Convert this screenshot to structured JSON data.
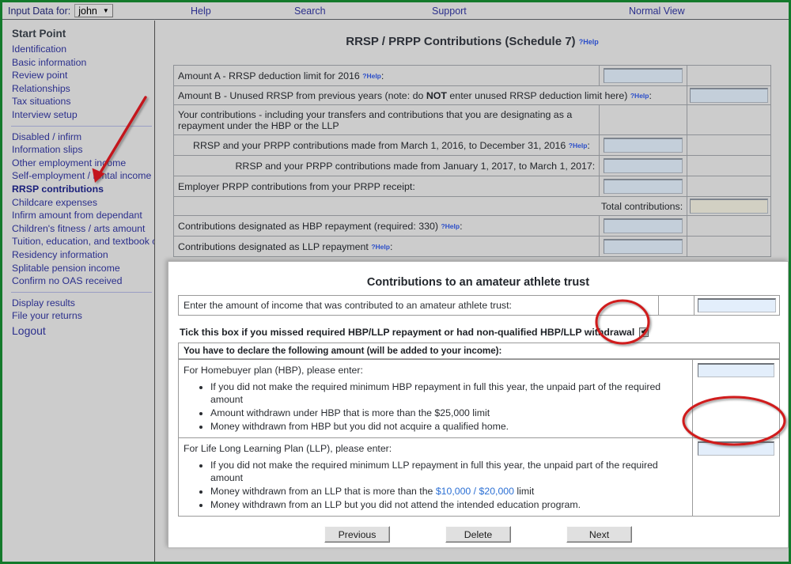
{
  "topbar": {
    "input_data_label": "Input Data for:",
    "user": "john",
    "caret": "▼",
    "help": "Help",
    "search": "Search",
    "support": "Support",
    "normal_view": "Normal View"
  },
  "sidebar": {
    "title": "Start Point",
    "group1": [
      {
        "label": "Identification"
      },
      {
        "label": "Basic information"
      },
      {
        "label": "Review point"
      },
      {
        "label": "Relationships"
      },
      {
        "label": "Tax situations"
      },
      {
        "label": "Interview setup"
      }
    ],
    "group2": [
      {
        "label": "Disabled / infirm",
        "active": false
      },
      {
        "label": "Information slips",
        "active": false
      },
      {
        "label": "Other employment income",
        "active": false
      },
      {
        "label": "Self-employment / rental income",
        "active": false
      },
      {
        "label": "RRSP contributions",
        "active": true
      },
      {
        "label": "Childcare expenses",
        "active": false
      },
      {
        "label": "Infirm amount from dependant",
        "active": false
      },
      {
        "label": "Children's fitness / arts amount",
        "active": false
      },
      {
        "label": "Tuition, education, and textbook cre",
        "active": false
      },
      {
        "label": "Residency information",
        "active": false
      },
      {
        "label": "Splitable pension income",
        "active": false
      },
      {
        "label": "Confirm no OAS received",
        "active": false
      }
    ],
    "group3": [
      {
        "label": "Display results"
      },
      {
        "label": "File your returns"
      }
    ],
    "logout": "Logout"
  },
  "main": {
    "page_title": "RRSP / PRPP Contributions (Schedule 7)",
    "help_label": "?Help",
    "rows": [
      {
        "label": "Amount A - RRSP deduction limit for 2016",
        "help": true,
        "colon": ":",
        "field": "mid",
        "value": ""
      },
      {
        "label": "Amount B - Unused RRSP from previous years (note: do NOT enter unused RRSP deduction limit here)",
        "help": true,
        "colon": ":",
        "field": "right",
        "value": ""
      },
      {
        "label": "Your contributions - including your transfers and contributions that you are designating as a repayment under the HBP or the LLP",
        "help": false,
        "field": "none",
        "value": ""
      },
      {
        "label": "RRSP and your PRPP contributions made from March 1, 2016, to December 31, 2016",
        "help": true,
        "colon": ":",
        "indent": true,
        "field": "mid",
        "value": ""
      },
      {
        "label": "RRSP and your PRPP contributions made from January 1, 2017, to March 1, 2017:",
        "help": false,
        "align_right": true,
        "field": "mid",
        "value": ""
      },
      {
        "label": "Employer PRPP contributions from your PRPP receipt:",
        "help": false,
        "field": "mid",
        "value": ""
      },
      {
        "label": "Total contributions:",
        "help": false,
        "align_right": true,
        "field": "total",
        "value": ""
      },
      {
        "label": "Contributions designated as HBP repayment (required: 330)",
        "help": true,
        "colon": ":",
        "field": "mid",
        "value": ""
      },
      {
        "label": "Contributions designated as LLP repayment",
        "help": true,
        "colon": ":",
        "field": "select",
        "value": ""
      }
    ]
  },
  "overlay": {
    "title": "Contributions to an amateur athlete trust",
    "athlete_row_label": "Enter the amount of income that was contributed to an amateur athlete trust:",
    "athlete_value": "",
    "tick_label": "Tick this box if you missed required HBP/LLP repayment or had non-qualified HBP/LLP withdrawal",
    "tick_checked": true,
    "tick_glyph": "✔",
    "declare_label": "You have to declare the following amount (will be added to your income):",
    "hbp": {
      "lead": "For Homebuyer plan (HBP), please enter:",
      "bullets": [
        "If you did not make the required minimum HBP repayment in full this year, the unpaid part of the required amount",
        "Amount withdrawn under HBP that is more than the $25,000 limit",
        "Money withdrawn from HBP but you did not acquire a qualified home."
      ],
      "value": ""
    },
    "llp": {
      "lead": "For Life Long Learning Plan (LLP), please enter:",
      "bullets": [
        "If you did not make the required minimum LLP repayment in full this year, the unpaid part of the required amount",
        "Money withdrawn from an LLP that is more than the $10,000 / $20,000 limit",
        "Money withdrawn from an LLP but you did not attend the intended education program."
      ],
      "bullet2_prefix": "Money withdrawn from an LLP that is more than the ",
      "bullet2_amount": "$10,000 / $20,000",
      "bullet2_suffix": " limit",
      "value": ""
    },
    "buttons": {
      "previous": "Previous",
      "delete": "Delete",
      "next": "Next"
    }
  },
  "annotations": {
    "arrow_color": "#c4161c",
    "ellipse_color": "#d01a1f",
    "arrow_target": "RRSP contributions",
    "ellipse1_target": "tick-checkbox",
    "ellipse2_target": "hbp-amount-input"
  }
}
